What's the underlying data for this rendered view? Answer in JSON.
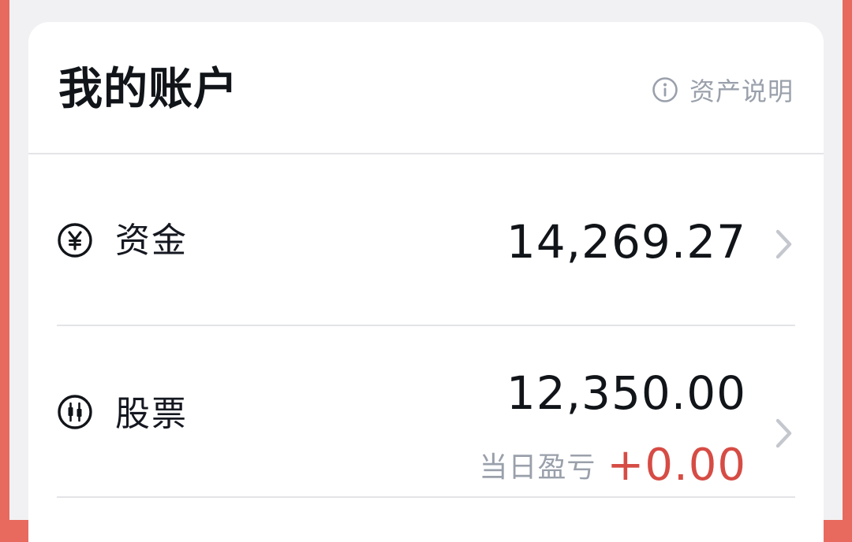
{
  "account": {
    "title": "我的账户",
    "asset_info_label": "资产说明"
  },
  "rows": [
    {
      "icon": "yen-circle-icon",
      "label": "资金",
      "amount": "14,269.27"
    },
    {
      "icon": "candlestick-circle-icon",
      "label": "股票",
      "amount": "12,350.00",
      "pnl_label": "当日盈亏",
      "pnl_value": "+0.00"
    }
  ],
  "colors": {
    "background_accent": "#e86a5f",
    "page_background": "#f1f1f3",
    "card": "#ffffff",
    "primary_text": "#111418",
    "secondary_text": "#9aa0ab",
    "profit_red": "#d64c45",
    "divider": "#e3e4e8"
  }
}
